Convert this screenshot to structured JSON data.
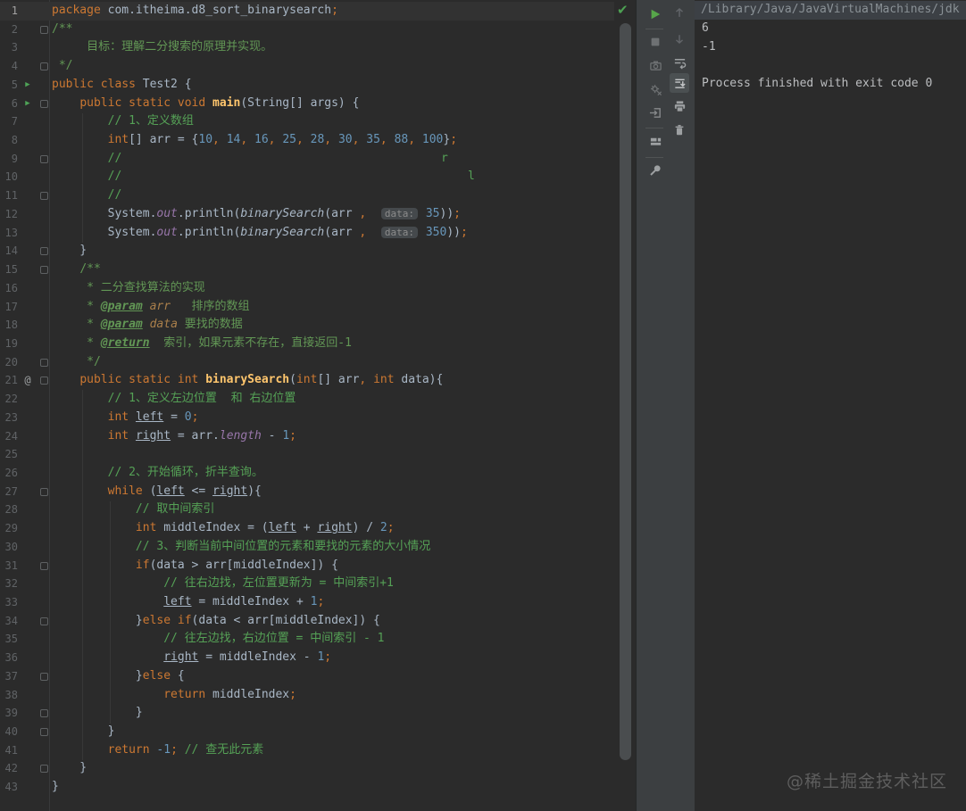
{
  "watermark": "@稀土掘金技术社区",
  "colors": {
    "editor_bg": "#2B2B2B",
    "toolbar_bg": "#3C3F41",
    "current_line": "#323232",
    "keyword": "#CC7832",
    "number": "#6897BB",
    "comment": "#55A156",
    "doc": "#629755",
    "method": "#FFC66D",
    "field": "#9876AA",
    "text": "#A9B7C6",
    "run_green": "#4FA457"
  },
  "icons": {
    "editor": [
      "inspections-ok-check-icon"
    ],
    "toolbar_left": [
      "rerun-play-icon",
      "stop-icon",
      "camera-thread-dump-icon",
      "build-gear-icon",
      "attach-arrow-box-icon",
      "restore-layout-icon",
      "pin-icon"
    ],
    "toolbar_right": [
      "arrow-up-icon",
      "arrow-down-icon",
      "soft-wrap-icon",
      "scroll-to-end-icon",
      "print-icon",
      "clear-trash-icon"
    ],
    "scroll_to_end_selected": true
  },
  "console": {
    "lines": [
      {
        "text": "/Library/Java/JavaVirtualMachines/jdk",
        "cls": "path"
      },
      {
        "text": "6",
        "cls": ""
      },
      {
        "text": "-1",
        "cls": ""
      },
      {
        "text": "",
        "cls": ""
      },
      {
        "text": "Process finished with exit code 0",
        "cls": ""
      }
    ]
  },
  "editor": {
    "lines": [
      {
        "n": 1,
        "cur": true,
        "t": [
          [
            "k",
            "package"
          ],
          [
            "p",
            " com.itheima.d8_sort_binarysearch"
          ],
          [
            "s",
            ";"
          ]
        ]
      },
      {
        "n": 2,
        "f": "s",
        "t": [
          [
            "d",
            "/**"
          ]
        ]
      },
      {
        "n": 3,
        "t": [
          [
            "d",
            "     目标：理解二分搜索的原理并实现。"
          ]
        ]
      },
      {
        "n": 4,
        "f": "e",
        "t": [
          [
            "d",
            " */"
          ]
        ]
      },
      {
        "n": 5,
        "ic": "run",
        "t": [
          [
            "k",
            "public class "
          ],
          [
            "p",
            "Test2 {"
          ]
        ]
      },
      {
        "n": 6,
        "ic": "run",
        "f": "s",
        "t": [
          [
            "p",
            "    "
          ],
          [
            "k",
            "public static void "
          ],
          [
            "m",
            "main"
          ],
          [
            "p",
            "(String[] args) {"
          ]
        ]
      },
      {
        "n": 7,
        "t": [
          [
            "p",
            "        "
          ],
          [
            "c",
            "// 1、定义数组"
          ]
        ]
      },
      {
        "n": 8,
        "t": [
          [
            "p",
            "        "
          ],
          [
            "k",
            "int"
          ],
          [
            "p",
            "[] arr = {"
          ],
          [
            "n",
            "10"
          ],
          [
            "s",
            ", "
          ],
          [
            "n",
            "14"
          ],
          [
            "s",
            ", "
          ],
          [
            "n",
            "16"
          ],
          [
            "s",
            ", "
          ],
          [
            "n",
            "25"
          ],
          [
            "s",
            ", "
          ],
          [
            "n",
            "28"
          ],
          [
            "s",
            ", "
          ],
          [
            "n",
            "30"
          ],
          [
            "s",
            ", "
          ],
          [
            "n",
            "35"
          ],
          [
            "s",
            ", "
          ],
          [
            "n",
            "88"
          ],
          [
            "s",
            ", "
          ],
          [
            "n",
            "100"
          ],
          [
            "p",
            "}"
          ],
          [
            "s",
            ";"
          ]
        ]
      },
      {
        "n": 9,
        "f": "s",
        "t": [
          [
            "p",
            "        "
          ],
          [
            "c",
            "//"
          ],
          [
            "c",
            "r",
            436
          ]
        ]
      },
      {
        "n": 10,
        "t": [
          [
            "p",
            "        "
          ],
          [
            "c",
            "//"
          ],
          [
            "c",
            "l",
            466
          ]
        ]
      },
      {
        "n": 11,
        "f": "e",
        "t": [
          [
            "p",
            "        "
          ],
          [
            "c",
            "//"
          ]
        ]
      },
      {
        "n": 12,
        "t": [
          [
            "p",
            "        System."
          ],
          [
            "f",
            "out"
          ],
          [
            "p",
            ".println("
          ],
          [
            "mi",
            "binarySearch"
          ],
          [
            "p",
            "(arr "
          ],
          [
            "s",
            ","
          ],
          [
            "p",
            "  "
          ],
          [
            "hint",
            "data:"
          ],
          [
            "p",
            " "
          ],
          [
            "n",
            "35"
          ],
          [
            "p",
            "))"
          ],
          [
            "s",
            ";"
          ]
        ]
      },
      {
        "n": 13,
        "t": [
          [
            "p",
            "        System."
          ],
          [
            "f",
            "out"
          ],
          [
            "p",
            ".println("
          ],
          [
            "mi",
            "binarySearch"
          ],
          [
            "p",
            "(arr "
          ],
          [
            "s",
            ","
          ],
          [
            "p",
            "  "
          ],
          [
            "hint",
            "data:"
          ],
          [
            "p",
            " "
          ],
          [
            "n",
            "350"
          ],
          [
            "p",
            "))"
          ],
          [
            "s",
            ";"
          ]
        ]
      },
      {
        "n": 14,
        "f": "e",
        "t": [
          [
            "p",
            "    }"
          ]
        ]
      },
      {
        "n": 15,
        "f": "s",
        "t": [
          [
            "p",
            "    "
          ],
          [
            "d",
            "/**"
          ]
        ]
      },
      {
        "n": 16,
        "t": [
          [
            "p",
            "     "
          ],
          [
            "d",
            "* 二分查找算法的实现"
          ]
        ]
      },
      {
        "n": 17,
        "t": [
          [
            "p",
            "     "
          ],
          [
            "d",
            "* "
          ],
          [
            "dt",
            "@param"
          ],
          [
            "d",
            " "
          ],
          [
            "dp",
            "arr"
          ],
          [
            "d",
            "   排序的数组"
          ]
        ]
      },
      {
        "n": 18,
        "t": [
          [
            "p",
            "     "
          ],
          [
            "d",
            "* "
          ],
          [
            "dt",
            "@param"
          ],
          [
            "d",
            " "
          ],
          [
            "dp",
            "data"
          ],
          [
            "d",
            " 要找的数据"
          ]
        ]
      },
      {
        "n": 19,
        "t": [
          [
            "p",
            "     "
          ],
          [
            "d",
            "* "
          ],
          [
            "dt",
            "@return"
          ],
          [
            "d",
            "  索引，如果元素不存在，直接返回-1"
          ]
        ]
      },
      {
        "n": 20,
        "f": "e",
        "t": [
          [
            "p",
            "     "
          ],
          [
            "d",
            "*/"
          ]
        ]
      },
      {
        "n": 21,
        "ic": "at",
        "f": "s",
        "t": [
          [
            "p",
            "    "
          ],
          [
            "k",
            "public static int "
          ],
          [
            "m",
            "binarySearch"
          ],
          [
            "p",
            "("
          ],
          [
            "k",
            "int"
          ],
          [
            "p",
            "[] arr"
          ],
          [
            "s",
            ","
          ],
          [
            "p",
            " "
          ],
          [
            "k",
            "int"
          ],
          [
            "p",
            " data){"
          ]
        ]
      },
      {
        "n": 22,
        "t": [
          [
            "p",
            "        "
          ],
          [
            "c",
            "// 1、定义左边位置  和 右边位置"
          ]
        ]
      },
      {
        "n": 23,
        "t": [
          [
            "p",
            "        "
          ],
          [
            "k",
            "int"
          ],
          [
            "p",
            " "
          ],
          [
            "u",
            "left"
          ],
          [
            "p",
            " = "
          ],
          [
            "n",
            "0"
          ],
          [
            "s",
            ";"
          ]
        ]
      },
      {
        "n": 24,
        "t": [
          [
            "p",
            "        "
          ],
          [
            "k",
            "int"
          ],
          [
            "p",
            " "
          ],
          [
            "u",
            "right"
          ],
          [
            "p",
            " = arr."
          ],
          [
            "f",
            "length"
          ],
          [
            "p",
            " - "
          ],
          [
            "n",
            "1"
          ],
          [
            "s",
            ";"
          ]
        ]
      },
      {
        "n": 25,
        "t": []
      },
      {
        "n": 26,
        "t": [
          [
            "p",
            "        "
          ],
          [
            "c",
            "// 2、开始循环，折半查询。"
          ]
        ]
      },
      {
        "n": 27,
        "f": "s",
        "t": [
          [
            "p",
            "        "
          ],
          [
            "k",
            "while"
          ],
          [
            "p",
            " ("
          ],
          [
            "u",
            "left"
          ],
          [
            "p",
            " <= "
          ],
          [
            "u",
            "right"
          ],
          [
            "p",
            "){"
          ]
        ]
      },
      {
        "n": 28,
        "t": [
          [
            "p",
            "            "
          ],
          [
            "c",
            "// 取中间索引"
          ]
        ]
      },
      {
        "n": 29,
        "t": [
          [
            "p",
            "            "
          ],
          [
            "k",
            "int"
          ],
          [
            "p",
            " middleIndex = ("
          ],
          [
            "u",
            "left"
          ],
          [
            "p",
            " + "
          ],
          [
            "u",
            "right"
          ],
          [
            "p",
            ") / "
          ],
          [
            "n",
            "2"
          ],
          [
            "s",
            ";"
          ]
        ]
      },
      {
        "n": 30,
        "t": [
          [
            "p",
            "            "
          ],
          [
            "c",
            "// 3、判断当前中间位置的元素和要找的元素的大小情况"
          ]
        ]
      },
      {
        "n": 31,
        "f": "s",
        "t": [
          [
            "p",
            "            "
          ],
          [
            "k",
            "if"
          ],
          [
            "p",
            "(data > arr[middleIndex]) {"
          ]
        ]
      },
      {
        "n": 32,
        "t": [
          [
            "p",
            "                "
          ],
          [
            "c",
            "// 往右边找，左位置更新为 = 中间索引+1"
          ]
        ]
      },
      {
        "n": 33,
        "t": [
          [
            "p",
            "                "
          ],
          [
            "u",
            "left"
          ],
          [
            "p",
            " = middleIndex + "
          ],
          [
            "n",
            "1"
          ],
          [
            "s",
            ";"
          ]
        ]
      },
      {
        "n": 34,
        "f": "e",
        "t": [
          [
            "p",
            "            }"
          ],
          [
            "k",
            "else if"
          ],
          [
            "p",
            "(data < arr[middleIndex]) {"
          ]
        ]
      },
      {
        "n": 35,
        "t": [
          [
            "p",
            "                "
          ],
          [
            "c",
            "// 往左边找，右边位置 = 中间索引 - 1"
          ]
        ]
      },
      {
        "n": 36,
        "t": [
          [
            "p",
            "                "
          ],
          [
            "u",
            "right"
          ],
          [
            "p",
            " = middleIndex - "
          ],
          [
            "n",
            "1"
          ],
          [
            "s",
            ";"
          ]
        ]
      },
      {
        "n": 37,
        "f": "s",
        "t": [
          [
            "p",
            "            }"
          ],
          [
            "k",
            "else"
          ],
          [
            "p",
            " {"
          ]
        ]
      },
      {
        "n": 38,
        "t": [
          [
            "p",
            "                "
          ],
          [
            "k",
            "return"
          ],
          [
            "p",
            " middleIndex"
          ],
          [
            "s",
            ";"
          ]
        ]
      },
      {
        "n": 39,
        "f": "e",
        "t": [
          [
            "p",
            "            }"
          ]
        ]
      },
      {
        "n": 40,
        "f": "e",
        "t": [
          [
            "p",
            "        }"
          ]
        ]
      },
      {
        "n": 41,
        "t": [
          [
            "p",
            "        "
          ],
          [
            "k",
            "return"
          ],
          [
            "p",
            " "
          ],
          [
            "n",
            "-1"
          ],
          [
            "s",
            ";"
          ],
          [
            "c",
            " // 查无此元素"
          ]
        ]
      },
      {
        "n": 42,
        "f": "e",
        "t": [
          [
            "p",
            "    }"
          ]
        ]
      },
      {
        "n": 43,
        "t": [
          [
            "p",
            "}"
          ]
        ]
      }
    ]
  }
}
